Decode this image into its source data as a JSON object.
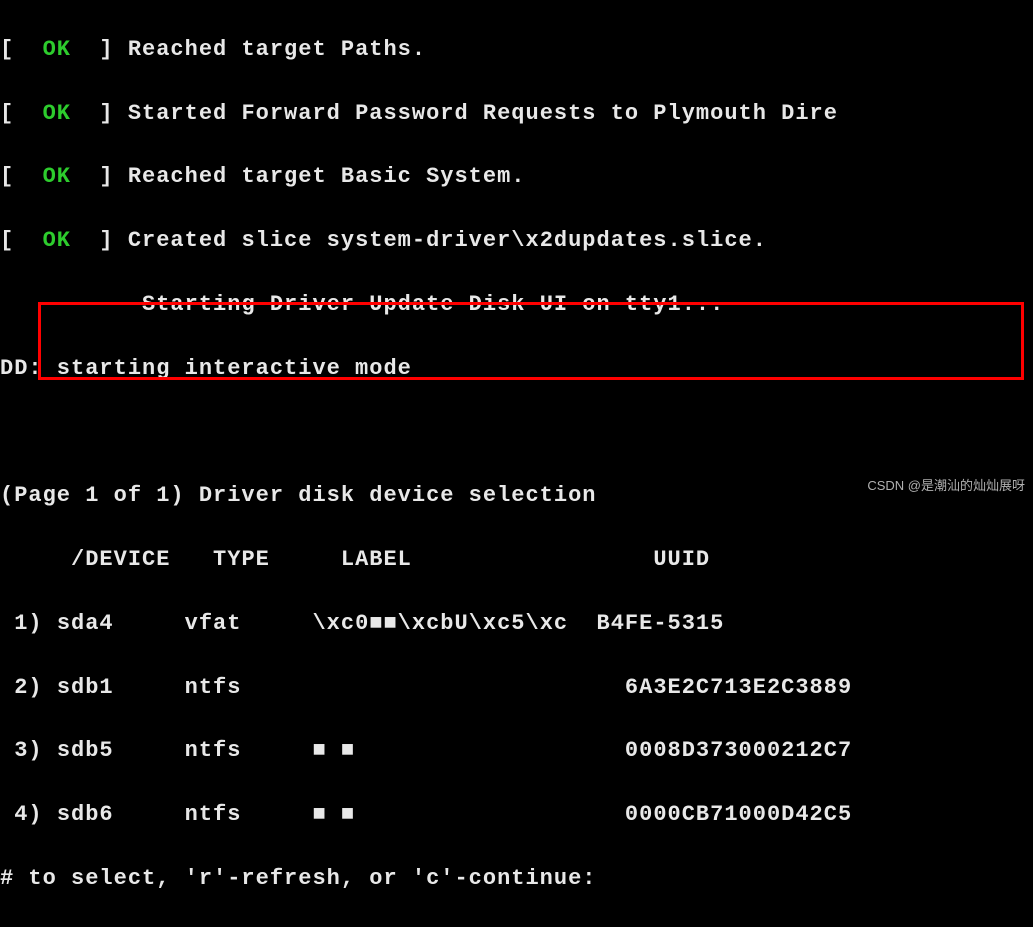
{
  "boot": {
    "lines": [
      {
        "status": "OK",
        "msg": "Reached target Paths."
      },
      {
        "status": "OK",
        "msg": "Started Forward Password Requests to Plymouth Dire"
      },
      {
        "status": "OK",
        "msg": "Reached target Basic System."
      },
      {
        "status": "OK",
        "msg": "Created slice system-driver\\x2dupdates.slice."
      }
    ],
    "starting": "Starting Driver Update Disk UI on tty1...",
    "dd": "DD: starting interactive mode"
  },
  "selection": {
    "title": "(Page 1 of 1) Driver disk device selection",
    "header": {
      "device": "/DEVICE",
      "type": "TYPE",
      "label": "LABEL",
      "uuid": "UUID"
    },
    "rows": [
      {
        "n": "1)",
        "device": "sda4",
        "type": "vfat",
        "label": "\\xc0■■\\xcbU\\xc5\\xc",
        "uuid": "B4FE-5315"
      },
      {
        "n": "2)",
        "device": "sdb1",
        "type": "ntfs",
        "label": "",
        "uuid": "6A3E2C713E2C3889"
      },
      {
        "n": "3)",
        "device": "sdb5",
        "type": "ntfs",
        "label": "■ ■",
        "uuid": "0008D373000212C7"
      },
      {
        "n": "4)",
        "device": "sdb6",
        "type": "ntfs",
        "label": "■ ■",
        "uuid": "0000CB71000D42C5"
      }
    ],
    "prompt": "# to select, 'r'-refresh, or 'c'-continue:"
  },
  "watermark": "CSDN @是潮汕的灿灿展呀"
}
